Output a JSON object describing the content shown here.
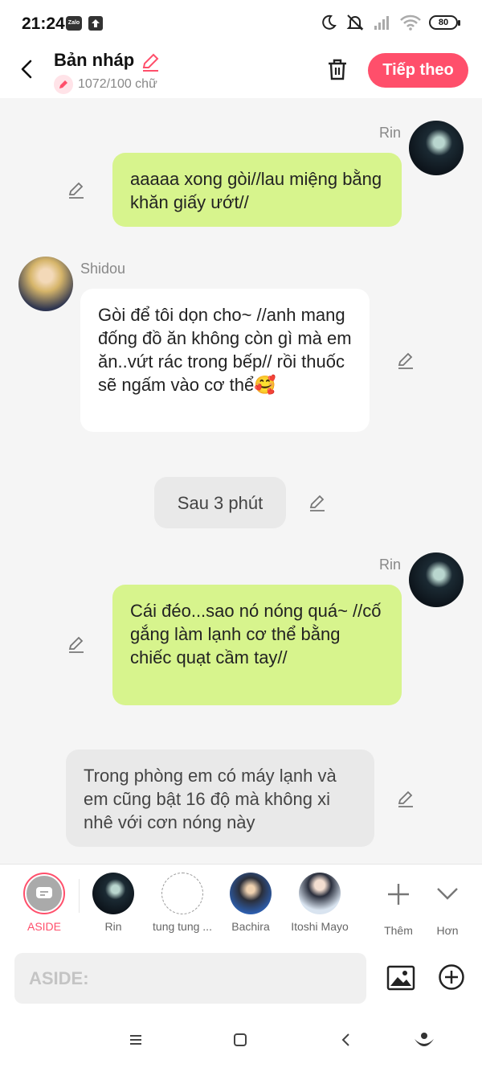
{
  "status_bar": {
    "time": "21:24",
    "zalo_label": "Zalo",
    "battery": "80"
  },
  "header": {
    "title": "Bản nháp",
    "word_count": "1072/100 chữ",
    "next_label": "Tiếp theo"
  },
  "messages": [
    {
      "sender": "Rin",
      "text": "aaaaa xong gòi//lau miệng bằng khăn giấy ướt//"
    },
    {
      "sender": "Shidou",
      "text": "Gòi để tôi dọn cho~ //anh mang đống đồ ăn không còn gì mà em ăn..vứt rác trong bếp// rồi thuốc sẽ ngấm vào cơ thể🥰"
    },
    {
      "sender": "",
      "text": "Sau 3 phút"
    },
    {
      "sender": "Rin",
      "text": "Cái đéo...sao nó nóng quá~ //cố gắng làm lạnh cơ thể bằng chiếc quạt cầm tay//"
    },
    {
      "sender": "",
      "text": "Trong phòng em có máy lạnh và em cũng bật 16 độ mà không xi nhê với cơn nóng này"
    }
  ],
  "characters": [
    {
      "label": "ASIDE"
    },
    {
      "label": "Rin"
    },
    {
      "label": "tung tung ..."
    },
    {
      "label": "Bachira"
    },
    {
      "label": "Itoshi Mayo"
    }
  ],
  "actions": {
    "add_label": "Thêm",
    "more_label": "Hơn"
  },
  "input": {
    "placeholder": "ASIDE:"
  },
  "colors": {
    "accent": "#ff4f6b",
    "green_bubble": "#d7f48d"
  }
}
